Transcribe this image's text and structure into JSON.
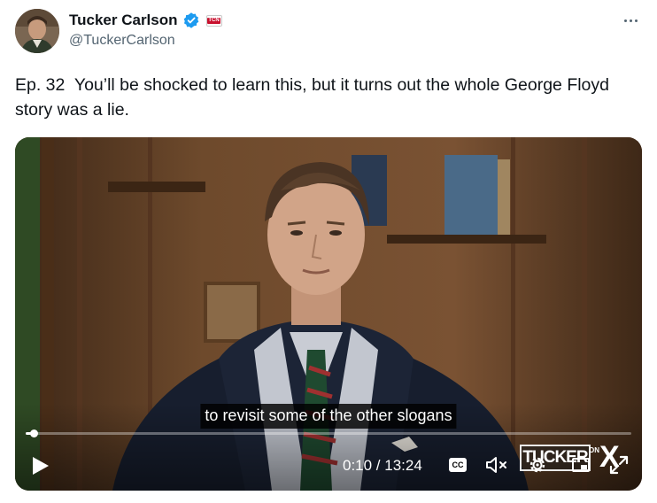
{
  "author": {
    "display_name": "Tucker Carlson",
    "handle": "@TuckerCarlson",
    "verified": true,
    "affiliate_badge": "TCN"
  },
  "tweet": {
    "text": "Ep. 32  You’ll be shocked to learn this, but it turns out the whole George Floyd story was a lie."
  },
  "video": {
    "caption": "to revisit some of the other slogans",
    "current_time": "0:10",
    "duration": "13:24",
    "time_display": "0:10 / 13:24",
    "progress_fraction": 0.0125,
    "cc_label": "CC",
    "watermark": {
      "brand": "TUCKER",
      "on": "ON",
      "x": "X"
    }
  },
  "icons": {
    "more": "more-icon",
    "verified": "verified-badge-icon",
    "play": "play-icon",
    "mute": "volume-muted-icon",
    "settings": "gear-icon",
    "pip": "picture-in-picture-icon",
    "fullscreen": "fullscreen-icon"
  },
  "colors": {
    "verified": "#1d9bf0",
    "text_primary": "#0f1419",
    "text_secondary": "#536471",
    "badge_red": "#c8102e"
  }
}
